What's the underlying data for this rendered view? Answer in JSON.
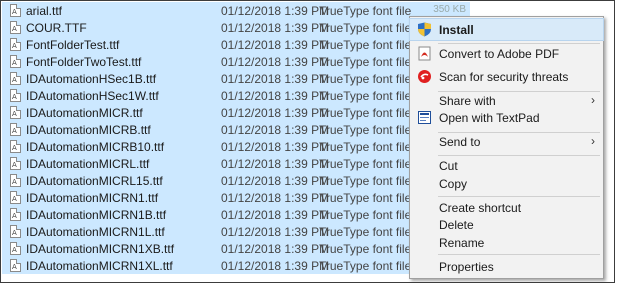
{
  "files": [
    {
      "name": "arial.ttf",
      "date": "01/12/2018 1:39 PM",
      "type": "TrueType font file",
      "size": "350 KB"
    },
    {
      "name": "COUR.TTF",
      "date": "01/12/2018 1:39 PM",
      "type": "TrueType font file",
      "size": ""
    },
    {
      "name": "FontFolderTest.ttf",
      "date": "01/12/2018 1:39 PM",
      "type": "TrueType font file",
      "size": ""
    },
    {
      "name": "FontFolderTwoTest.ttf",
      "date": "01/12/2018 1:39 PM",
      "type": "TrueType font file",
      "size": ""
    },
    {
      "name": "IDAutomationHSec1B.ttf",
      "date": "01/12/2018 1:39 PM",
      "type": "TrueType font file",
      "size": ""
    },
    {
      "name": "IDAutomationHSec1W.ttf",
      "date": "01/12/2018 1:39 PM",
      "type": "TrueType font file",
      "size": ""
    },
    {
      "name": "IDAutomationMICR.ttf",
      "date": "01/12/2018 1:39 PM",
      "type": "TrueType font file",
      "size": ""
    },
    {
      "name": "IDAutomationMICRB.ttf",
      "date": "01/12/2018 1:39 PM",
      "type": "TrueType font file",
      "size": ""
    },
    {
      "name": "IDAutomationMICRB10.ttf",
      "date": "01/12/2018 1:39 PM",
      "type": "TrueType font file",
      "size": ""
    },
    {
      "name": "IDAutomationMICRL.ttf",
      "date": "01/12/2018 1:39 PM",
      "type": "TrueType font file",
      "size": ""
    },
    {
      "name": "IDAutomationMICRL15.ttf",
      "date": "01/12/2018 1:39 PM",
      "type": "TrueType font file",
      "size": ""
    },
    {
      "name": "IDAutomationMICRN1.ttf",
      "date": "01/12/2018 1:39 PM",
      "type": "TrueType font file",
      "size": ""
    },
    {
      "name": "IDAutomationMICRN1B.ttf",
      "date": "01/12/2018 1:39 PM",
      "type": "TrueType font file",
      "size": ""
    },
    {
      "name": "IDAutomationMICRN1L.ttf",
      "date": "01/12/2018 1:39 PM",
      "type": "TrueType font file",
      "size": ""
    },
    {
      "name": "IDAutomationMICRN1XB.ttf",
      "date": "01/12/2018 1:39 PM",
      "type": "TrueType font file",
      "size": ""
    },
    {
      "name": "IDAutomationMICRN1XL.ttf",
      "date": "01/12/2018 1:39 PM",
      "type": "TrueType font file",
      "size": ""
    }
  ],
  "file_icon_text": "A",
  "context_menu": {
    "install": "Install",
    "convert_pdf": "Convert to Adobe PDF",
    "scan": "Scan for security threats",
    "share_with": "Share with",
    "open_textpad": "Open with TextPad",
    "send_to": "Send to",
    "cut": "Cut",
    "copy": "Copy",
    "create_shortcut": "Create shortcut",
    "delete": "Delete",
    "rename": "Rename",
    "properties": "Properties",
    "submenu_arrow": "›"
  },
  "colors": {
    "selection": "#cce8ff",
    "menu_background": "#f2f2f2",
    "menu_highlight": "#d8eaf9"
  }
}
